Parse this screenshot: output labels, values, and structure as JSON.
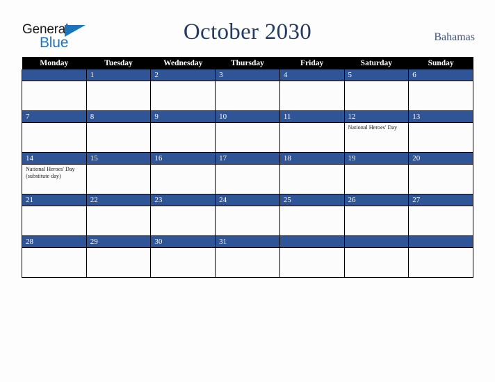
{
  "brand": {
    "name_part1": "General",
    "name_part2": "Blue",
    "triangle_icon": "triangle-icon",
    "color_dark": "#1A1A1A",
    "color_blue": "#1E74BB"
  },
  "header": {
    "title": "October 2030",
    "country": "Bahamas",
    "title_color": "#243C65",
    "country_color": "#3C5380"
  },
  "calendar": {
    "accent_color": "#2F5597",
    "header_bg": "#000000",
    "cell_bg": "#FCFCFC",
    "weekday_headers": [
      "Monday",
      "Tuesday",
      "Wednesday",
      "Thursday",
      "Friday",
      "Saturday",
      "Sunday"
    ],
    "weeks": [
      [
        {
          "day": "",
          "events": ""
        },
        {
          "day": "1",
          "events": ""
        },
        {
          "day": "2",
          "events": ""
        },
        {
          "day": "3",
          "events": ""
        },
        {
          "day": "4",
          "events": ""
        },
        {
          "day": "5",
          "events": ""
        },
        {
          "day": "6",
          "events": ""
        }
      ],
      [
        {
          "day": "7",
          "events": ""
        },
        {
          "day": "8",
          "events": ""
        },
        {
          "day": "9",
          "events": ""
        },
        {
          "day": "10",
          "events": ""
        },
        {
          "day": "11",
          "events": ""
        },
        {
          "day": "12",
          "events": "National Heroes' Day"
        },
        {
          "day": "13",
          "events": ""
        }
      ],
      [
        {
          "day": "14",
          "events": "National Heroes' Day (substitute day)"
        },
        {
          "day": "15",
          "events": ""
        },
        {
          "day": "16",
          "events": ""
        },
        {
          "day": "17",
          "events": ""
        },
        {
          "day": "18",
          "events": ""
        },
        {
          "day": "19",
          "events": ""
        },
        {
          "day": "20",
          "events": ""
        }
      ],
      [
        {
          "day": "21",
          "events": ""
        },
        {
          "day": "22",
          "events": ""
        },
        {
          "day": "23",
          "events": ""
        },
        {
          "day": "24",
          "events": ""
        },
        {
          "day": "25",
          "events": ""
        },
        {
          "day": "26",
          "events": ""
        },
        {
          "day": "27",
          "events": ""
        }
      ],
      [
        {
          "day": "28",
          "events": ""
        },
        {
          "day": "29",
          "events": ""
        },
        {
          "day": "30",
          "events": ""
        },
        {
          "day": "31",
          "events": ""
        },
        {
          "day": "",
          "events": ""
        },
        {
          "day": "",
          "events": ""
        },
        {
          "day": "",
          "events": ""
        }
      ]
    ]
  }
}
